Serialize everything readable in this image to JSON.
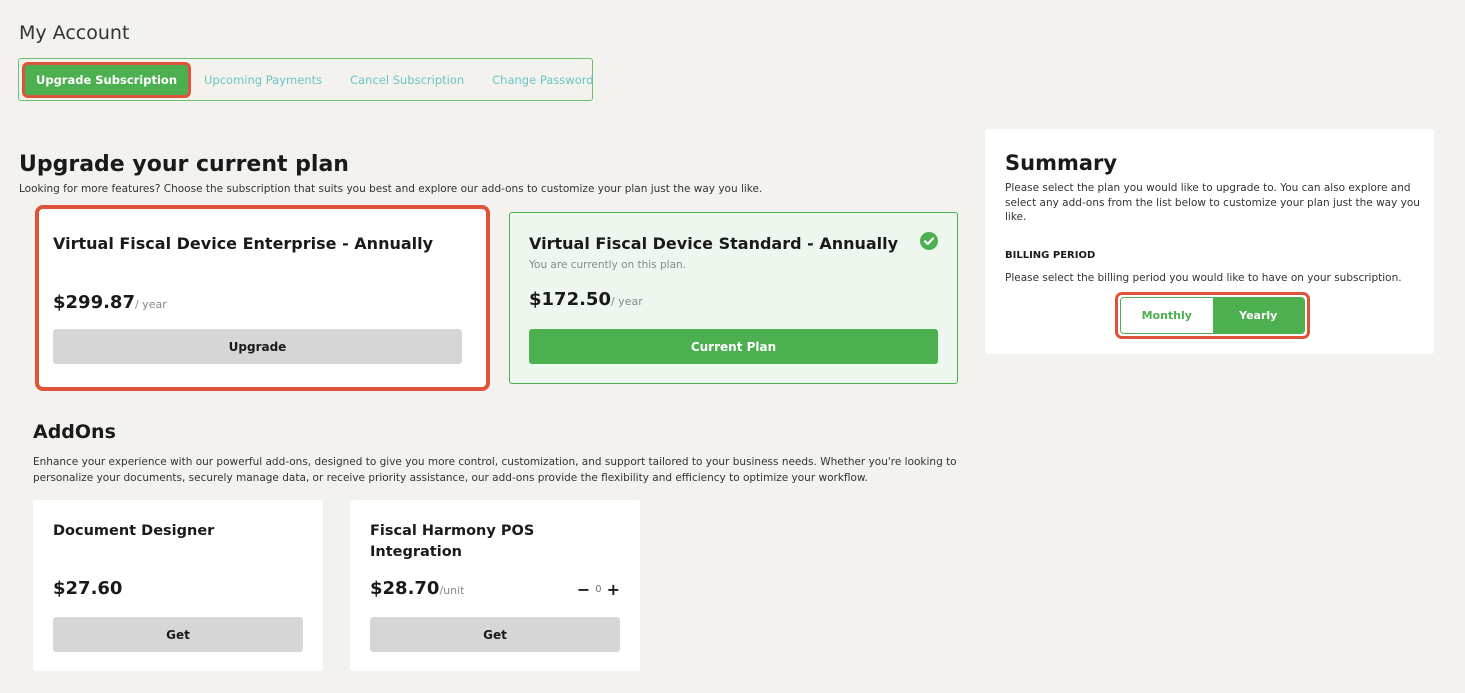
{
  "page": {
    "title": "My Account"
  },
  "tabs": [
    {
      "label": "Upgrade Subscription",
      "active": true
    },
    {
      "label": "Upcoming Payments",
      "active": false
    },
    {
      "label": "Cancel Subscription",
      "active": false
    },
    {
      "label": "Change Password",
      "active": false
    }
  ],
  "upgrade": {
    "title": "Upgrade your current plan",
    "description": "Looking for more features? Choose the subscription that suits you best and explore our add-ons to customize your plan just the way you like."
  },
  "plans": [
    {
      "name": "Virtual Fiscal Device Enterprise - Annually",
      "note": "",
      "price": "$299.87",
      "unit": "/ year",
      "button": "Upgrade",
      "current": false
    },
    {
      "name": "Virtual Fiscal Device Standard - Annually",
      "note": "You are currently on this plan.",
      "price": "$172.50",
      "unit": "/ year",
      "button": "Current Plan",
      "current": true
    }
  ],
  "summary": {
    "title": "Summary",
    "description": "Please select the plan you would like to upgrade to. You can also explore and select any add-ons from the list below to customize your plan just the way you like.",
    "billing_heading": "BILLING PERIOD",
    "billing_description": "Please select the billing period you would like to have on your subscription.",
    "billing_options": [
      "Monthly",
      "Yearly"
    ],
    "billing_selected": "Yearly"
  },
  "addons": {
    "title": "AddOns",
    "description": "Enhance your experience with our powerful add-ons, designed to give you more control, customization, and support tailored to your business needs. Whether you're looking to personalize your documents, securely manage data, or receive priority assistance, our add-ons provide the flexibility and efficiency to optimize your workflow.",
    "items": [
      {
        "name": "Document Designer",
        "price": "$27.60",
        "unit": "",
        "button": "Get"
      },
      {
        "name": "Fiscal Harmony POS Integration",
        "price": "$28.70",
        "unit": "/unit",
        "button": "Get",
        "quantity": "0",
        "minus": "−",
        "plus": "+"
      }
    ]
  },
  "colors": {
    "accent": "#4caf50",
    "tab_link": "#6ac6c0",
    "highlight": "#e0533b",
    "background": "#f3f2ef"
  }
}
